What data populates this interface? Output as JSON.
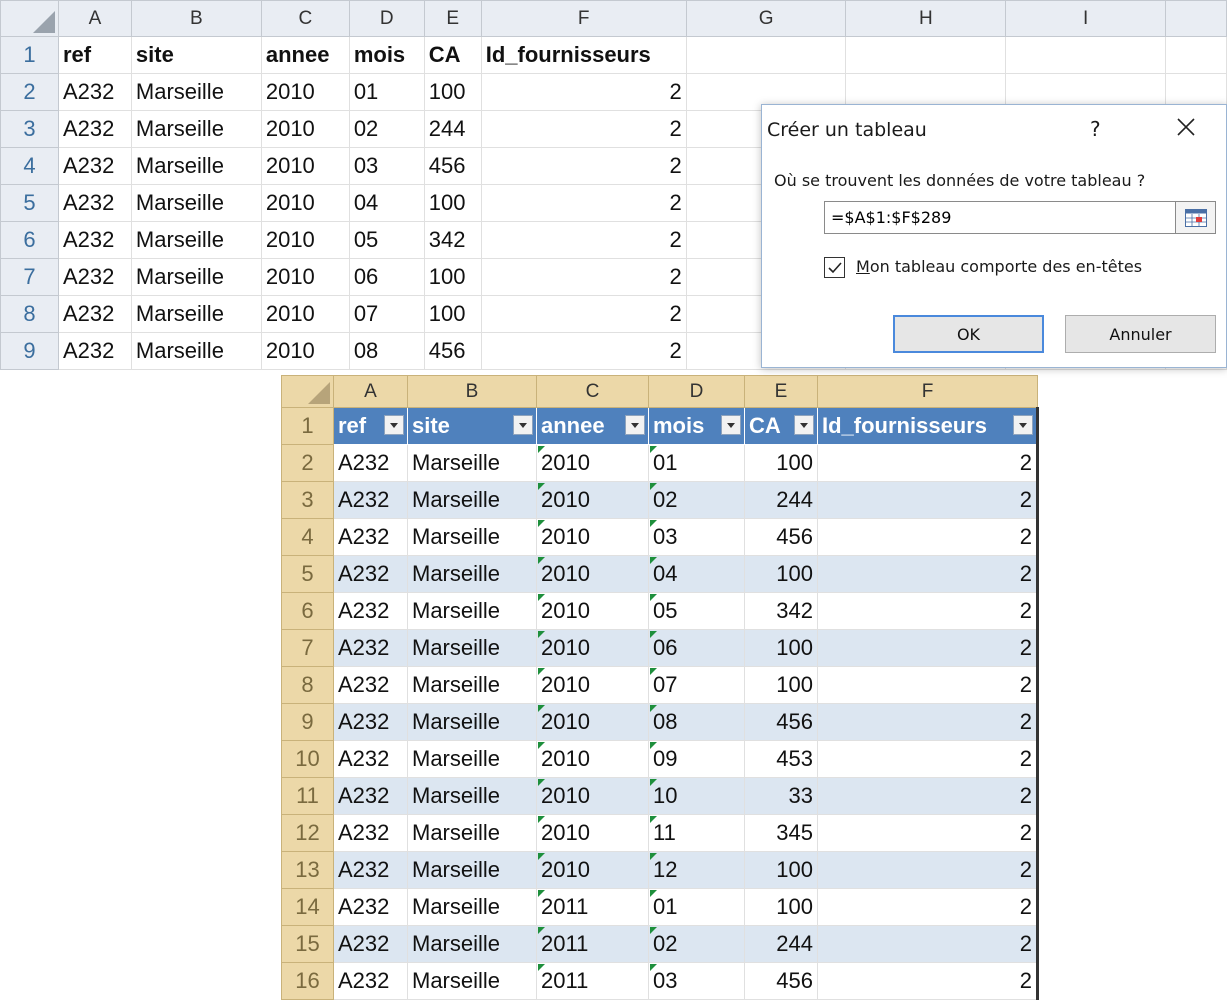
{
  "sheet1": {
    "columns": [
      "A",
      "B",
      "C",
      "D",
      "E",
      "F",
      "G",
      "H",
      "I"
    ],
    "header_row": {
      "num": "1",
      "cells": [
        "ref",
        "site",
        "annee",
        "mois",
        "CA",
        "Id_fournisseurs"
      ]
    },
    "rows": [
      {
        "num": "2",
        "cells": [
          "A232",
          "Marseille",
          "2010",
          "01",
          "100",
          "2"
        ]
      },
      {
        "num": "3",
        "cells": [
          "A232",
          "Marseille",
          "2010",
          "02",
          "244",
          "2"
        ]
      },
      {
        "num": "4",
        "cells": [
          "A232",
          "Marseille",
          "2010",
          "03",
          "456",
          "2"
        ]
      },
      {
        "num": "5",
        "cells": [
          "A232",
          "Marseille",
          "2010",
          "04",
          "100",
          "2"
        ]
      },
      {
        "num": "6",
        "cells": [
          "A232",
          "Marseille",
          "2010",
          "05",
          "342",
          "2"
        ]
      },
      {
        "num": "7",
        "cells": [
          "A232",
          "Marseille",
          "2010",
          "06",
          "100",
          "2"
        ]
      },
      {
        "num": "8",
        "cells": [
          "A232",
          "Marseille",
          "2010",
          "07",
          "100",
          "2"
        ]
      },
      {
        "num": "9",
        "cells": [
          "A232",
          "Marseille",
          "2010",
          "08",
          "456",
          "2"
        ]
      }
    ]
  },
  "dialog": {
    "title": "Créer un tableau",
    "help": "?",
    "prompt": "Où se trouvent les données de votre tableau ?",
    "range_value": "=$A$1:$F$289",
    "checkbox_label": "Mon tableau comporte des en-têtes",
    "checkbox_checked": true,
    "ok_label": "OK",
    "cancel_label": "Annuler"
  },
  "sheet2": {
    "columns": [
      "A",
      "B",
      "C",
      "D",
      "E",
      "F"
    ],
    "header_row": {
      "num": "1",
      "cells": [
        "ref",
        "site",
        "annee",
        "mois",
        "CA",
        "Id_fournisseurs"
      ]
    },
    "rows": [
      {
        "num": "2",
        "cells": [
          "A232",
          "Marseille",
          "2010",
          "01",
          "100",
          "2"
        ]
      },
      {
        "num": "3",
        "cells": [
          "A232",
          "Marseille",
          "2010",
          "02",
          "244",
          "2"
        ]
      },
      {
        "num": "4",
        "cells": [
          "A232",
          "Marseille",
          "2010",
          "03",
          "456",
          "2"
        ]
      },
      {
        "num": "5",
        "cells": [
          "A232",
          "Marseille",
          "2010",
          "04",
          "100",
          "2"
        ]
      },
      {
        "num": "6",
        "cells": [
          "A232",
          "Marseille",
          "2010",
          "05",
          "342",
          "2"
        ]
      },
      {
        "num": "7",
        "cells": [
          "A232",
          "Marseille",
          "2010",
          "06",
          "100",
          "2"
        ]
      },
      {
        "num": "8",
        "cells": [
          "A232",
          "Marseille",
          "2010",
          "07",
          "100",
          "2"
        ]
      },
      {
        "num": "9",
        "cells": [
          "A232",
          "Marseille",
          "2010",
          "08",
          "456",
          "2"
        ]
      },
      {
        "num": "10",
        "cells": [
          "A232",
          "Marseille",
          "2010",
          "09",
          "453",
          "2"
        ]
      },
      {
        "num": "11",
        "cells": [
          "A232",
          "Marseille",
          "2010",
          "10",
          "33",
          "2"
        ]
      },
      {
        "num": "12",
        "cells": [
          "A232",
          "Marseille",
          "2010",
          "11",
          "345",
          "2"
        ]
      },
      {
        "num": "13",
        "cells": [
          "A232",
          "Marseille",
          "2010",
          "12",
          "100",
          "2"
        ]
      },
      {
        "num": "14",
        "cells": [
          "A232",
          "Marseille",
          "2011",
          "01",
          "100",
          "2"
        ]
      },
      {
        "num": "15",
        "cells": [
          "A232",
          "Marseille",
          "2011",
          "02",
          "244",
          "2"
        ]
      },
      {
        "num": "16",
        "cells": [
          "A232",
          "Marseille",
          "2011",
          "03",
          "456",
          "2"
        ]
      }
    ]
  },
  "colors": {
    "table_header": "#4f81bd",
    "table_band": "#dce6f1",
    "dialog_ok_border": "#4a89dc",
    "number_marker": "#1e8f3c"
  }
}
